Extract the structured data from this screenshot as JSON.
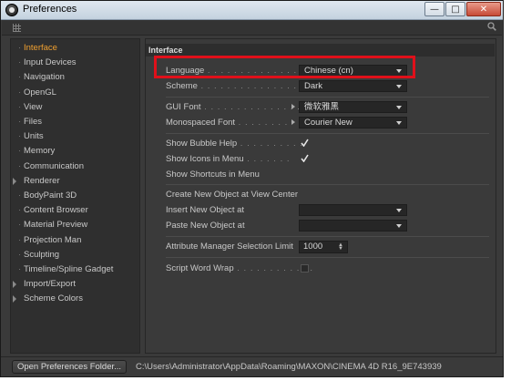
{
  "window": {
    "title": "Preferences",
    "controls": {
      "minimize": "—",
      "maximize": "□",
      "close": "✕"
    }
  },
  "sidebar": {
    "items": [
      {
        "label": "Interface",
        "selected": true,
        "expandable": false
      },
      {
        "label": "Input Devices",
        "selected": false,
        "expandable": false
      },
      {
        "label": "Navigation",
        "selected": false,
        "expandable": false
      },
      {
        "label": "OpenGL",
        "selected": false,
        "expandable": false
      },
      {
        "label": "View",
        "selected": false,
        "expandable": false
      },
      {
        "label": "Files",
        "selected": false,
        "expandable": false
      },
      {
        "label": "Units",
        "selected": false,
        "expandable": false
      },
      {
        "label": "Memory",
        "selected": false,
        "expandable": false
      },
      {
        "label": "Communication",
        "selected": false,
        "expandable": false
      },
      {
        "label": "Renderer",
        "selected": false,
        "expandable": true
      },
      {
        "label": "BodyPaint 3D",
        "selected": false,
        "expandable": false
      },
      {
        "label": "Content Browser",
        "selected": false,
        "expandable": false
      },
      {
        "label": "Material Preview",
        "selected": false,
        "expandable": false
      },
      {
        "label": "Projection Man",
        "selected": false,
        "expandable": false
      },
      {
        "label": "Sculpting",
        "selected": false,
        "expandable": false
      },
      {
        "label": "Timeline/Spline Gadget",
        "selected": false,
        "expandable": false
      },
      {
        "label": "Import/Export",
        "selected": false,
        "expandable": true
      },
      {
        "label": "Scheme Colors",
        "selected": false,
        "expandable": true
      }
    ]
  },
  "main": {
    "section_title": "Interface",
    "language": {
      "label": "Language",
      "value": "Chinese (cn)"
    },
    "scheme": {
      "label": "Scheme",
      "value": "Dark"
    },
    "gui_font": {
      "label": "GUI Font",
      "value": "微软雅黑"
    },
    "mono_font": {
      "label": "Monospaced Font",
      "value": "Courier New"
    },
    "bubble_help": {
      "label": "Show Bubble Help",
      "checked": true
    },
    "icons_menu": {
      "label": "Show Icons in Menu",
      "checked": true
    },
    "shortcuts_menu": {
      "label": "Show Shortcuts in Menu"
    },
    "create_new": {
      "label": "Create New Object at View Center"
    },
    "insert_new": {
      "label": "Insert New Object at",
      "value": ""
    },
    "paste_new": {
      "label": "Paste New Object at",
      "value": ""
    },
    "attr_limit": {
      "label": "Attribute Manager Selection Limit",
      "value": "1000"
    },
    "word_wrap": {
      "label": "Script Word Wrap",
      "checked": false
    }
  },
  "footer": {
    "button_label": "Open Preferences Folder...",
    "path": "C:\\Users\\Administrator\\AppData\\Roaming\\MAXON\\CINEMA 4D R16_9E743939"
  },
  "colors": {
    "background": "#3a3a3a",
    "selected_item": "#f0a030",
    "highlight": "#e0101a",
    "title_bar": "#c4d2df"
  }
}
